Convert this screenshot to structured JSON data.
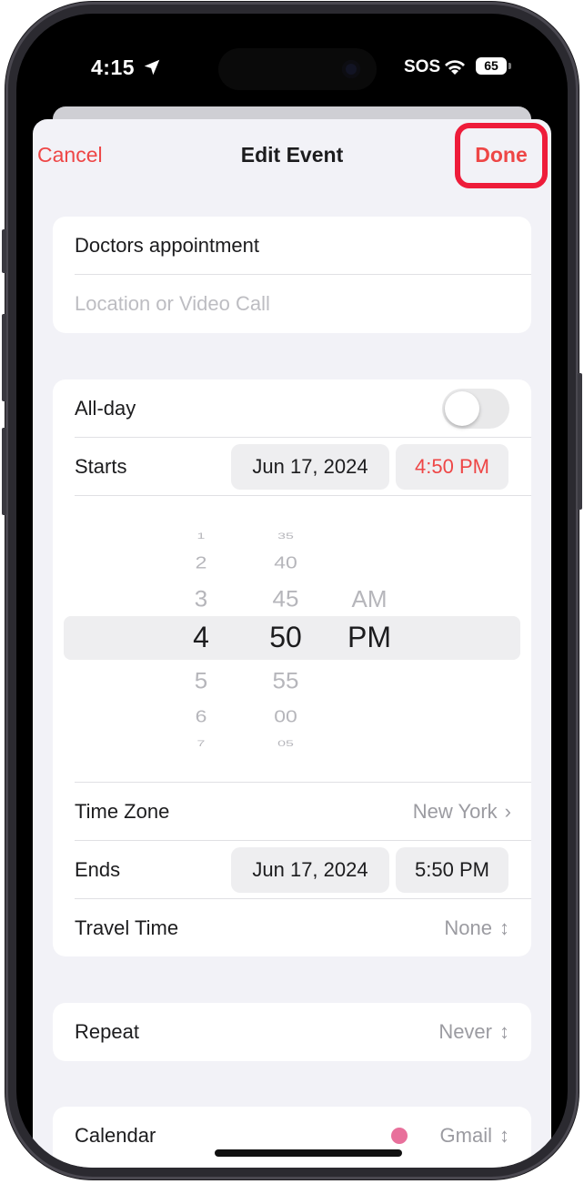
{
  "status_bar": {
    "time": "4:15",
    "sos": "SOS",
    "battery": "65"
  },
  "nav": {
    "cancel": "Cancel",
    "title": "Edit Event",
    "done": "Done"
  },
  "event": {
    "title": "Doctors appointment",
    "location_placeholder": "Location or Video Call"
  },
  "timing": {
    "all_day_label": "All-day",
    "all_day_on": false,
    "starts_label": "Starts",
    "starts_date": "Jun 17, 2024",
    "starts_time": "4:50 PM",
    "picker": {
      "hours": [
        "1",
        "2",
        "3",
        "4",
        "5",
        "6",
        "7"
      ],
      "minutes": [
        "35",
        "40",
        "45",
        "50",
        "55",
        "00",
        "05"
      ],
      "meridiem": [
        "AM",
        "PM"
      ],
      "selected": {
        "hour": "4",
        "minute": "50",
        "meridiem": "PM"
      }
    },
    "time_zone_label": "Time Zone",
    "time_zone_value": "New York",
    "ends_label": "Ends",
    "ends_date": "Jun 17, 2024",
    "ends_time": "5:50 PM",
    "travel_label": "Travel Time",
    "travel_value": "None"
  },
  "repeat": {
    "label": "Repeat",
    "value": "Never"
  },
  "calendar": {
    "label": "Calendar",
    "value": "Gmail",
    "color": "#e8709b"
  },
  "colors": {
    "accent": "#ee4646",
    "highlight": "#ee1c3a"
  }
}
